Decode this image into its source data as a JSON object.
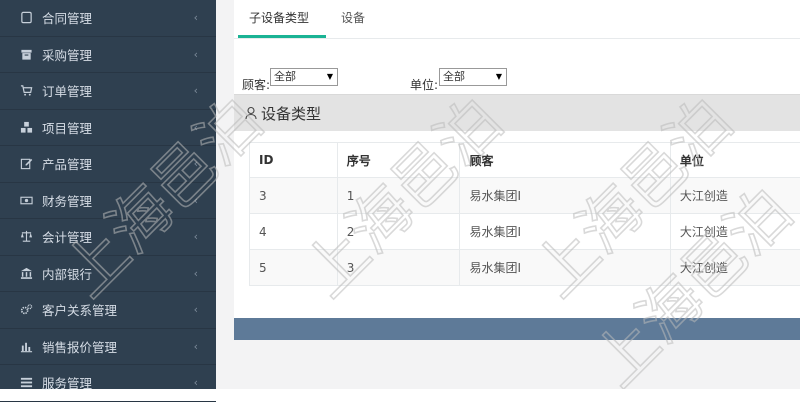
{
  "sidebar": {
    "items": [
      {
        "label": "合同管理",
        "icon": "contract-icon"
      },
      {
        "label": "采购管理",
        "icon": "purchase-icon"
      },
      {
        "label": "订单管理",
        "icon": "cart-icon"
      },
      {
        "label": "项目管理",
        "icon": "cubes-icon"
      },
      {
        "label": "产品管理",
        "icon": "edit-icon"
      },
      {
        "label": "财务管理",
        "icon": "money-icon"
      },
      {
        "label": "会计管理",
        "icon": "balance-scale-icon"
      },
      {
        "label": "内部银行",
        "icon": "bank-icon"
      },
      {
        "label": "客户关系管理",
        "icon": "cogs-icon"
      },
      {
        "label": "销售报价管理",
        "icon": "bar-chart-icon"
      },
      {
        "label": "服务管理",
        "icon": "list-icon"
      }
    ],
    "chevron": "‹"
  },
  "tabs": [
    {
      "label": "子设备类型",
      "active": true
    },
    {
      "label": "设备",
      "active": false
    }
  ],
  "filters": {
    "customer_label": "顾客:",
    "customer_value": "全部",
    "unit_label": "单位:",
    "unit_value": "全部"
  },
  "panel": {
    "title": "设备类型"
  },
  "table": {
    "headers": [
      "ID",
      "序号",
      "顾客",
      "单位"
    ],
    "rows": [
      [
        "3",
        "1",
        "易水集团I",
        "大江创造"
      ],
      [
        "4",
        "2",
        "易水集团I",
        "大江创造"
      ],
      [
        "5",
        "3",
        "易水集团I",
        "大江创造"
      ]
    ]
  },
  "watermark": {
    "text": "上海邑泊"
  },
  "colors": {
    "sidebar": "#2f4050",
    "accent": "#1ab394",
    "footer_bar": "#5e7a98"
  }
}
